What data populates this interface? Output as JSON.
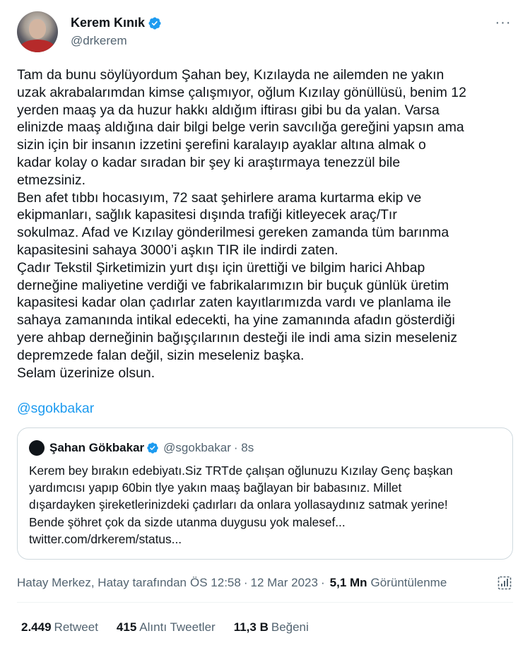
{
  "author": {
    "name": "Kerem Kınık",
    "handle": "@drkerem"
  },
  "more_label": "···",
  "tweet_lines": [
    "Tam da bunu söylüyordum Şahan bey, Kızılayda ne ailemden ne yakın",
    "uzak akrabalarımdan kimse çalışmıyor, oğlum Kızılay gönüllüsü, benim 12",
    "yerden maaş ya da huzur hakkı aldığım iftirası gibi bu da yalan. Varsa",
    "elinizde maaş aldığına dair bilgi belge verin savcılığa gereğini yapsın ama",
    "sizin için bir insanın izzetini şerefini karalayıp ayaklar altına almak o",
    "kadar kolay o kadar sıradan bir şey ki araştırmaya tenezzül bile",
    "etmezsiniz.",
    "Ben afet tıbbı hocasıyım, 72 saat şehirlere arama kurtarma ekip ve",
    "ekipmanları, sağlık kapasitesi dışında trafiği kitleyecek araç/Tır",
    "sokulmaz. Afad ve Kızılay gönderilmesi gereken zamanda tüm barınma",
    "kapasitesini sahaya 3000’i aşkın TIR ile indirdi zaten.",
    "Çadır Tekstil Şirketimizin yurt dışı için ürettiği ve bilgim harici Ahbap",
    "derneğine maliyetine verdiği ve fabrikalarımızın bir buçuk günlük üretim",
    "kapasitesi kadar olan çadırlar zaten kayıtlarımızda vardı ve planlama ile",
    "sahaya zamanında intikal edecekti, ha yine zamanında afadın gösterdiği",
    "yere ahbap derneğinin bağışçılarının desteği ile indi ama sizin meseleniz",
    "depremzede falan değil, sizin meseleniz başka.",
    "Selam üzerinize olsun."
  ],
  "mention": "@sgokbakar",
  "quote": {
    "name": "Şahan Gökbakar",
    "handle": "@sgokbakar",
    "time": "· 8s",
    "lines": [
      "Kerem bey bırakın edebiyatı.Siz TRTde çalışan oğlunuzu Kızılay Genç başkan",
      "yardımcısı yapıp 60bin tlye yakın maaş bağlayan bir babasınız. Millet",
      "dışardayken şireketlerinizdeki çadırları da onlara yollasaydınız satmak yerine!",
      "Bende şöhret çok da sizde utanma duygusu yok malesef...",
      "twitter.com/drkerem/status..."
    ]
  },
  "meta": {
    "source": "Hatay Merkez, Hatay tarafından",
    "time": "ÖS 12:58",
    "date": "12 Mar 2023",
    "views_count": "5,1 Mn",
    "views_label": "Görüntülenme",
    "separator": "·"
  },
  "stats": [
    {
      "count": "2.449",
      "label": "Retweet"
    },
    {
      "count": "415",
      "label": "Alıntı Tweetler"
    },
    {
      "count": "11,3 B",
      "label": "Beğeni"
    }
  ],
  "colors": {
    "accent": "#1d9bf0",
    "secondary_text": "#536471",
    "primary_text": "#0f1419",
    "border": "#cfd9de"
  },
  "icons": {
    "verified": "verified-badge-icon",
    "more": "more-options-icon",
    "analytics": "analytics-icon"
  }
}
